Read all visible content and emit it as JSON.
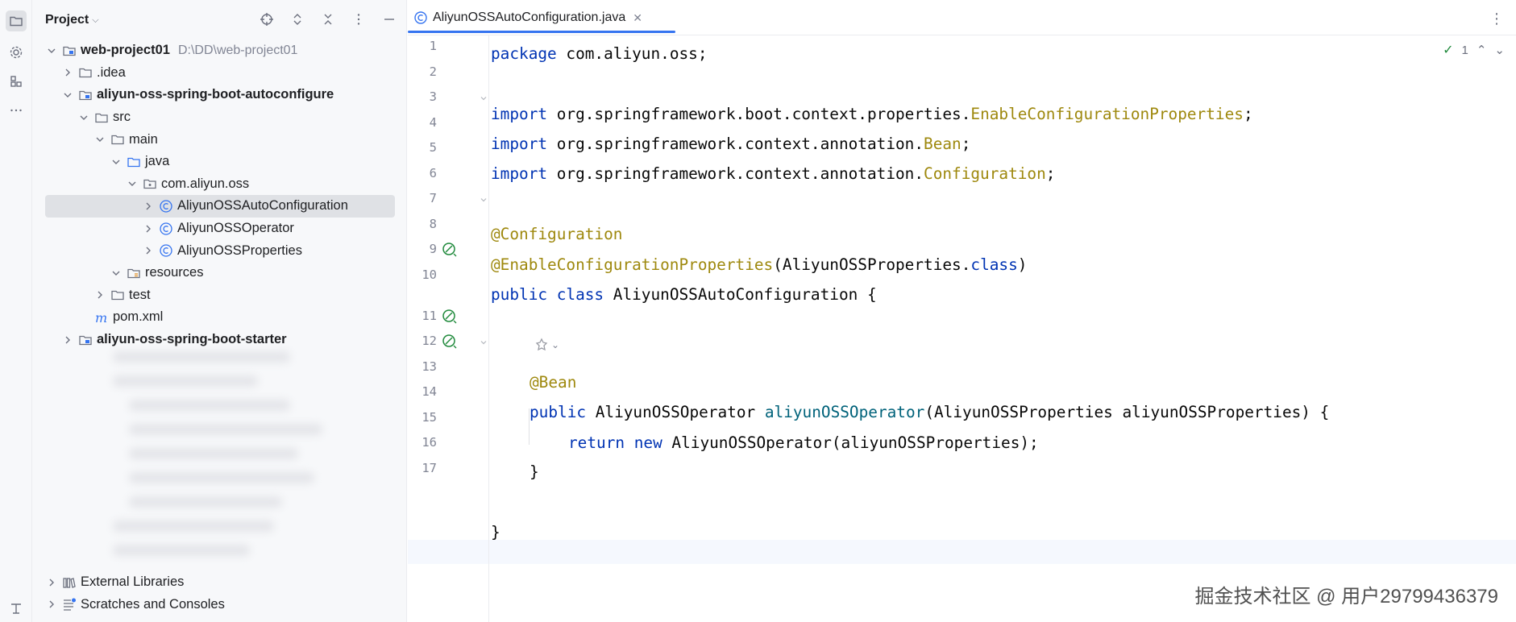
{
  "project_panel": {
    "title": "Project",
    "tree": [
      {
        "label": "web-project01",
        "path": "D:\\DD\\web-project01",
        "bold": true,
        "level": 0,
        "expanded": true,
        "icon": "module-folder-icon"
      },
      {
        "label": ".idea",
        "level": 1,
        "expanded": false,
        "icon": "folder-icon"
      },
      {
        "label": "aliyun-oss-spring-boot-autoconfigure",
        "bold": true,
        "level": 1,
        "expanded": true,
        "icon": "module-folder-icon"
      },
      {
        "label": "src",
        "level": 2,
        "expanded": true,
        "icon": "folder-icon"
      },
      {
        "label": "main",
        "level": 3,
        "expanded": true,
        "icon": "folder-icon"
      },
      {
        "label": "java",
        "level": 4,
        "expanded": true,
        "icon": "source-folder-icon"
      },
      {
        "label": "com.aliyun.oss",
        "level": 5,
        "expanded": true,
        "icon": "package-icon"
      },
      {
        "label": "AliyunOSSAutoConfiguration",
        "level": 6,
        "expanded": false,
        "icon": "class-icon",
        "selected": true
      },
      {
        "label": "AliyunOSSOperator",
        "level": 6,
        "expanded": false,
        "icon": "class-icon"
      },
      {
        "label": "AliyunOSSProperties",
        "level": 6,
        "expanded": false,
        "icon": "class-icon"
      },
      {
        "label": "resources",
        "level": 4,
        "expanded": true,
        "icon": "resources-folder-icon"
      },
      {
        "label": "test",
        "level": 3,
        "expanded": false,
        "icon": "folder-icon"
      },
      {
        "label": "pom.xml",
        "level": 2,
        "icon": "maven-icon"
      },
      {
        "label": "aliyun-oss-spring-boot-starter",
        "bold": true,
        "level": 1,
        "expanded": false,
        "icon": "module-folder-icon"
      }
    ],
    "bottom": [
      {
        "label": "External Libraries",
        "icon": "library-icon"
      },
      {
        "label": "Scratches and Consoles",
        "icon": "scratches-icon"
      }
    ]
  },
  "editor": {
    "tab_label": "AliyunOSSAutoConfiguration.java",
    "inspection_count": "1",
    "lines": [
      {
        "n": "1"
      },
      {
        "n": "2"
      },
      {
        "n": "3"
      },
      {
        "n": "4"
      },
      {
        "n": "5"
      },
      {
        "n": "6"
      },
      {
        "n": "7"
      },
      {
        "n": "8"
      },
      {
        "n": "9"
      },
      {
        "n": "10"
      },
      {
        "n": "11"
      },
      {
        "n": "12"
      },
      {
        "n": "13"
      },
      {
        "n": "14"
      },
      {
        "n": "15"
      },
      {
        "n": "16"
      },
      {
        "n": "17"
      }
    ],
    "code": {
      "l1_kw": "package",
      "l1_rest": " com.aliyun.oss;",
      "l3_kw": "import",
      "l3_pkg": " org.springframework.boot.context.properties.",
      "l3_cls": "EnableConfigurationProperties",
      "l3_end": ";",
      "l4_kw": "import",
      "l4_pkg": " org.springframework.context.annotation.",
      "l4_cls": "Bean",
      "l4_end": ";",
      "l5_kw": "import",
      "l5_pkg": " org.springframework.context.annotation.",
      "l5_cls": "Configuration",
      "l5_end": ";",
      "l7_ann": "@Configuration",
      "l8_ann": "@EnableConfigurationProperties",
      "l8_open": "(AliyunOSSProperties.",
      "l8_kw": "class",
      "l8_close": ")",
      "l9_kw": "public class",
      "l9_rest": " AliyunOSSAutoConfiguration {",
      "l11_ann": "@Bean",
      "l12_kw": "public",
      "l12_type": " AliyunOSSOperator ",
      "l12_fn": "aliyunOSSOperator",
      "l12_rest": "(AliyunOSSProperties aliyunOSSProperties) {",
      "l13_kw": "return new",
      "l13_rest": " AliyunOSSOperator(aliyunOSSProperties);",
      "l14": "}",
      "l16": "}"
    }
  },
  "watermark": "掘金技术社区 @ 用户29799436379",
  "colors": {
    "accent": "#3574f0",
    "keyword": "#0033b3",
    "annotation": "#9e880d",
    "method": "#00627a"
  }
}
